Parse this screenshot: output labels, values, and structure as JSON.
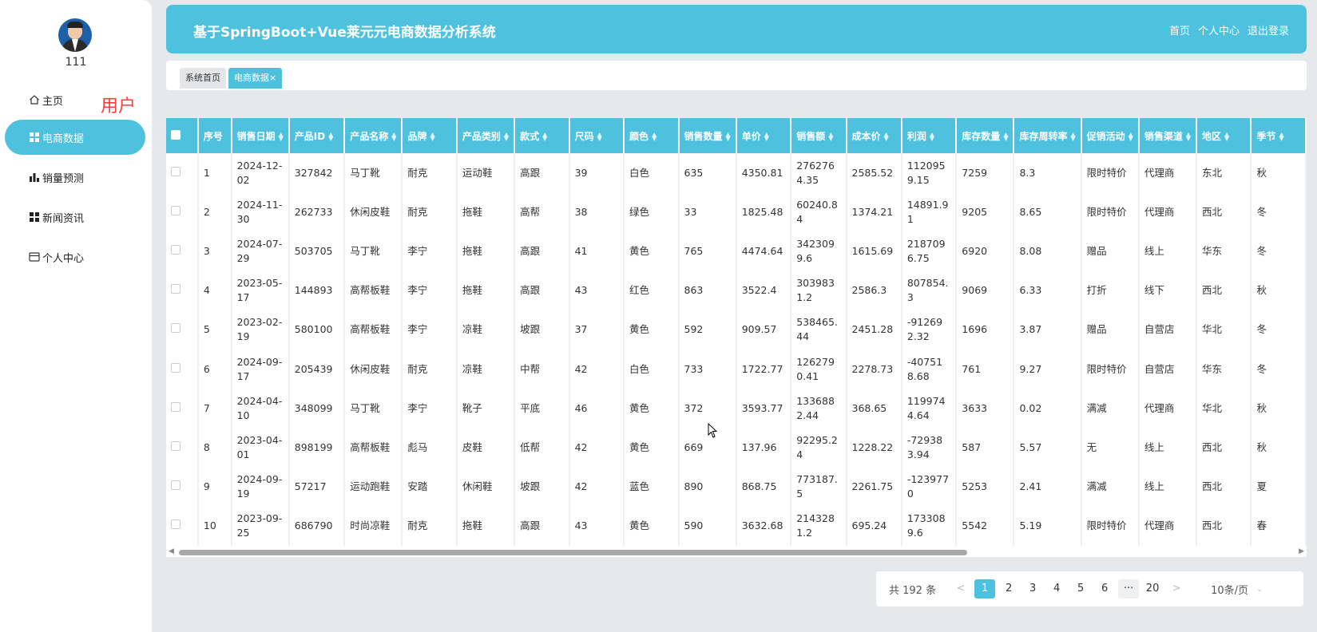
{
  "sidebar": {
    "username": "111",
    "role_label": "用户",
    "items": [
      {
        "label": "主页",
        "icon": "home-icon"
      },
      {
        "label": "电商数据",
        "icon": "grid-icon"
      },
      {
        "label": "销量预测",
        "icon": "bar-chart-icon"
      },
      {
        "label": "新闻资讯",
        "icon": "grid-icon"
      },
      {
        "label": "个人中心",
        "icon": "profile-card-icon"
      }
    ]
  },
  "header": {
    "title": "基于SpringBoot+Vue莱元元电商数据分析系统",
    "links": [
      "首页",
      "个人中心",
      "退出登录"
    ]
  },
  "tabs": [
    {
      "label": "系统首页"
    },
    {
      "label": "电商数据×"
    }
  ],
  "table": {
    "columns": [
      "序号",
      "销售日期",
      "产品ID",
      "产品名称",
      "品牌",
      "产品类别",
      "款式",
      "尺码",
      "颜色",
      "销售数量",
      "单价",
      "销售额",
      "成本价",
      "利润",
      "库存数量",
      "库存周转率",
      "促销活动",
      "销售渠道",
      "地区",
      "季节"
    ],
    "rows": [
      [
        "1",
        "2024-12-02",
        "327842",
        "马丁靴",
        "耐克",
        "运动鞋",
        "高跟",
        "39",
        "白色",
        "635",
        "4350.81",
        "2762764.35",
        "2585.52",
        "1120959.15",
        "7259",
        "8.3",
        "限时特价",
        "代理商",
        "东北",
        "秋"
      ],
      [
        "2",
        "2024-11-30",
        "262733",
        "休闲皮鞋",
        "耐克",
        "拖鞋",
        "高帮",
        "38",
        "绿色",
        "33",
        "1825.48",
        "60240.84",
        "1374.21",
        "14891.91",
        "9205",
        "8.65",
        "限时特价",
        "代理商",
        "西北",
        "冬"
      ],
      [
        "3",
        "2024-07-29",
        "503705",
        "马丁靴",
        "李宁",
        "拖鞋",
        "高跟",
        "41",
        "黄色",
        "765",
        "4474.64",
        "3423099.6",
        "1615.69",
        "2187096.75",
        "6920",
        "8.08",
        "赠品",
        "线上",
        "华东",
        "冬"
      ],
      [
        "4",
        "2023-05-17",
        "144893",
        "高帮板鞋",
        "李宁",
        "拖鞋",
        "高跟",
        "43",
        "红色",
        "863",
        "3522.4",
        "3039831.2",
        "2586.3",
        "807854.3",
        "9069",
        "6.33",
        "打折",
        "线下",
        "西北",
        "秋"
      ],
      [
        "5",
        "2023-02-19",
        "580100",
        "高帮板鞋",
        "李宁",
        "凉鞋",
        "坡跟",
        "37",
        "黄色",
        "592",
        "909.57",
        "538465.44",
        "2451.28",
        "-912692.32",
        "1696",
        "3.87",
        "赠品",
        "自营店",
        "华北",
        "冬"
      ],
      [
        "6",
        "2024-09-17",
        "205439",
        "休闲皮鞋",
        "耐克",
        "凉鞋",
        "中帮",
        "42",
        "白色",
        "733",
        "1722.77",
        "1262790.41",
        "2278.73",
        "-407518.68",
        "761",
        "9.27",
        "限时特价",
        "自营店",
        "华东",
        "冬"
      ],
      [
        "7",
        "2024-04-10",
        "348099",
        "马丁靴",
        "李宁",
        "靴子",
        "平底",
        "46",
        "黄色",
        "372",
        "3593.77",
        "1336882.44",
        "368.65",
        "1199744.64",
        "3633",
        "0.02",
        "满减",
        "代理商",
        "华北",
        "秋"
      ],
      [
        "8",
        "2023-04-01",
        "898199",
        "高帮板鞋",
        "彪马",
        "皮鞋",
        "低帮",
        "42",
        "黄色",
        "669",
        "137.96",
        "92295.24",
        "1228.22",
        "-729383.94",
        "587",
        "5.57",
        "无",
        "线上",
        "西北",
        "秋"
      ],
      [
        "9",
        "2024-09-19",
        "57217",
        "运动跑鞋",
        "安踏",
        "休闲鞋",
        "坡跟",
        "42",
        "蓝色",
        "890",
        "868.75",
        "773187.5",
        "2261.75",
        "-1239770",
        "5253",
        "2.41",
        "满减",
        "线上",
        "西北",
        "夏"
      ],
      [
        "10",
        "2023-09-25",
        "686790",
        "时尚凉鞋",
        "耐克",
        "拖鞋",
        "高跟",
        "43",
        "黄色",
        "590",
        "3632.68",
        "2143281.2",
        "695.24",
        "1733089.6",
        "5542",
        "5.19",
        "限时特价",
        "代理商",
        "西北",
        "春"
      ]
    ]
  },
  "pagination": {
    "total_text": "共 192 条",
    "prev": "<",
    "pages": [
      "1",
      "2",
      "3",
      "4",
      "5",
      "6"
    ],
    "ellipsis": "···",
    "last_page": "20",
    "next": ">",
    "page_size": "10条/页",
    "current_page": 1
  }
}
